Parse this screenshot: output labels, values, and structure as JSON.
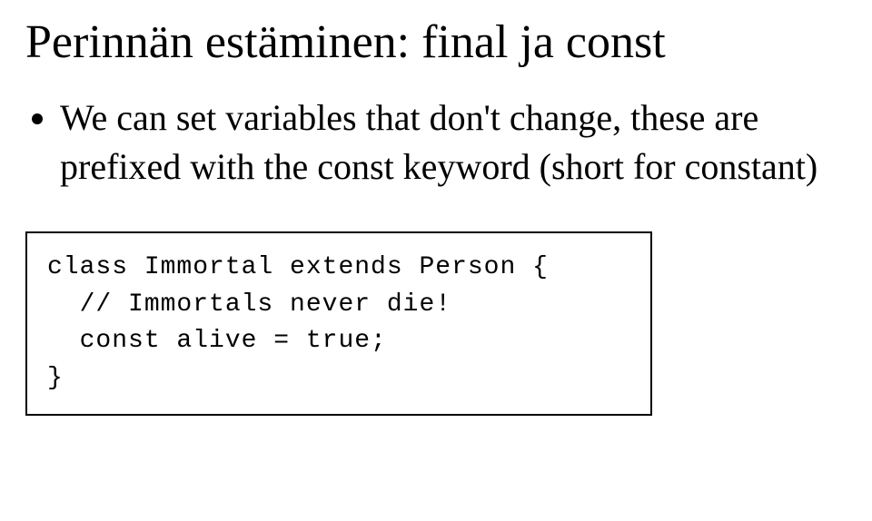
{
  "title": "Perinnän estäminen: final ja const",
  "bullets": [
    "We can set variables that don't change, these are prefixed with the const keyword (short for constant)"
  ],
  "code": "class Immortal extends Person {\n  // Immortals never die!\n  const alive = true;\n}"
}
